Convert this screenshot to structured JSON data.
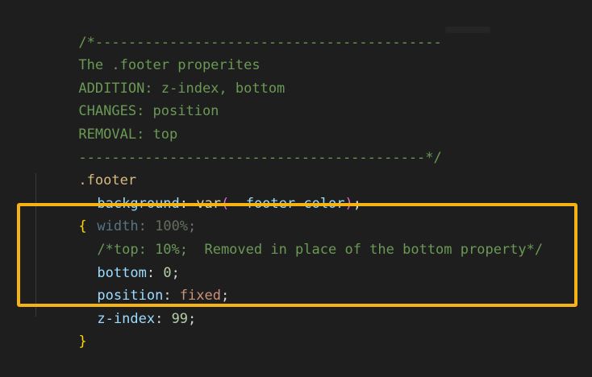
{
  "editor": {
    "lines": [
      {
        "comment": "/*------------------------------------------"
      },
      {
        "comment": "The .footer properites"
      },
      {
        "comment": "ADDITION: z-index, bottom"
      },
      {
        "comment": "CHANGES: position"
      },
      {
        "comment": "REMOVAL: top"
      },
      {
        "comment": "------------------------------------------*/"
      },
      {
        "selector": ".footer",
        "brace_open": "{"
      },
      {
        "prop": "background",
        "colon": ": ",
        "fn": "var",
        "paren_open": "(",
        "var": "--footer-color",
        "paren_close": ")",
        "semi": ";"
      },
      {
        "prop": "width",
        "colon": ": ",
        "value": "100%",
        "semi": ";"
      },
      {
        "comment": "/*top: 10%;  Removed in place of the bottom property*/"
      },
      {
        "prop": "bottom",
        "colon": ": ",
        "value": "0",
        "semi": ";"
      },
      {
        "prop": "position",
        "colon": ": ",
        "value": "fixed",
        "semi": ";"
      },
      {
        "prop": "z-index",
        "colon": ": ",
        "value": "99",
        "semi": ";"
      },
      {
        "brace_close": "}"
      }
    ]
  },
  "colors": {
    "highlight_border": "#f5b314",
    "background": "#1e1e1e",
    "comment": "#6a9955"
  }
}
